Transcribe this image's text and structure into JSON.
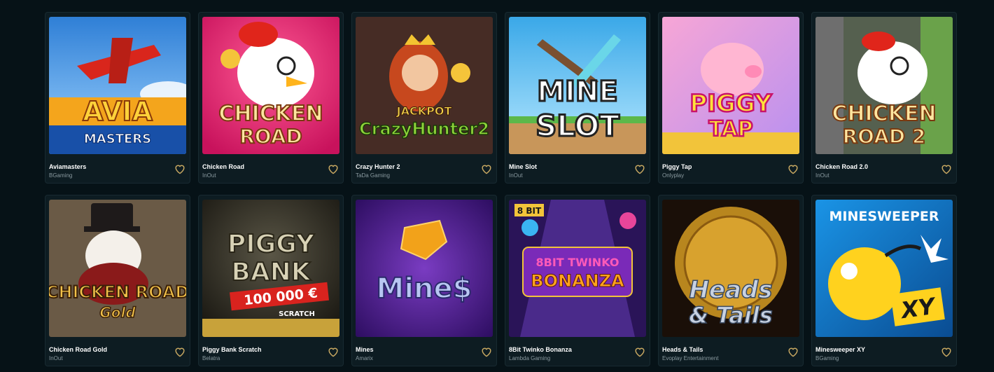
{
  "games": [
    {
      "title": "Aviamasters",
      "provider": "BGaming",
      "art_text": [
        "AVIA",
        "MASTERS"
      ],
      "colors": [
        "#3f8fe0",
        "#9fd4ff"
      ]
    },
    {
      "title": "Chicken Road",
      "provider": "InOut",
      "art_text": [
        "CHICKEN",
        "ROAD"
      ],
      "colors": [
        "#d81c6a",
        "#ff4e8a"
      ]
    },
    {
      "title": "Crazy Hunter 2",
      "provider": "TaDa Gaming",
      "art_text": [
        "JACKPOT",
        "CrazyHunter2"
      ],
      "colors": [
        "#3a2420",
        "#6a4436"
      ]
    },
    {
      "title": "Mine Slot",
      "provider": "InOut",
      "art_text": [
        "MINE",
        "SLOT"
      ],
      "colors": [
        "#4cb6ec",
        "#a6e2ff"
      ]
    },
    {
      "title": "Piggy Tap",
      "provider": "Onlyplay",
      "art_text": [
        "PIGGY",
        "TAP"
      ],
      "colors": [
        "#f6a9d9",
        "#c68ef2"
      ]
    },
    {
      "title": "Chicken Road 2.0",
      "provider": "InOut",
      "art_text": [
        "CHICKEN",
        "ROAD 2"
      ],
      "colors": [
        "#5a6a58",
        "#8ab26a"
      ]
    },
    {
      "title": "Chicken Road Gold",
      "provider": "InOut",
      "art_text": [
        "CHICKEN ROAD",
        "Gold"
      ],
      "colors": [
        "#5f4e3c",
        "#8a775d"
      ]
    },
    {
      "title": "Piggy Bank Scratch",
      "provider": "Belatra",
      "art_text": [
        "PIGGY",
        "BANK",
        "100 000 €",
        "SCRATCH"
      ],
      "colors": [
        "#1e1c16",
        "#4a473a"
      ]
    },
    {
      "title": "Mines",
      "provider": "Amarix",
      "art_text": [
        "Mine$"
      ],
      "colors": [
        "#4a1e8a",
        "#7a3cc2"
      ]
    },
    {
      "title": "8Bit Twinko Bonanza",
      "provider": "Lambda Gaming",
      "art_text": [
        "8 BIT",
        "8BIT TWINKO",
        "BONANZA"
      ],
      "colors": [
        "#2a1458",
        "#e8459a"
      ]
    },
    {
      "title": "Heads & Tails",
      "provider": "Evoplay Entertainment",
      "art_text": [
        "Heads",
        "& Tails"
      ],
      "colors": [
        "#1a0f08",
        "#b8861e"
      ]
    },
    {
      "title": "Minesweeper XY",
      "provider": "BGaming",
      "art_text": [
        "MINESWEEPER",
        "XY"
      ],
      "colors": [
        "#1284d6",
        "#0a5aa4"
      ]
    }
  ],
  "icons": {
    "favorite": "heart-outline-icon",
    "favorite_color": "#c9a962"
  }
}
